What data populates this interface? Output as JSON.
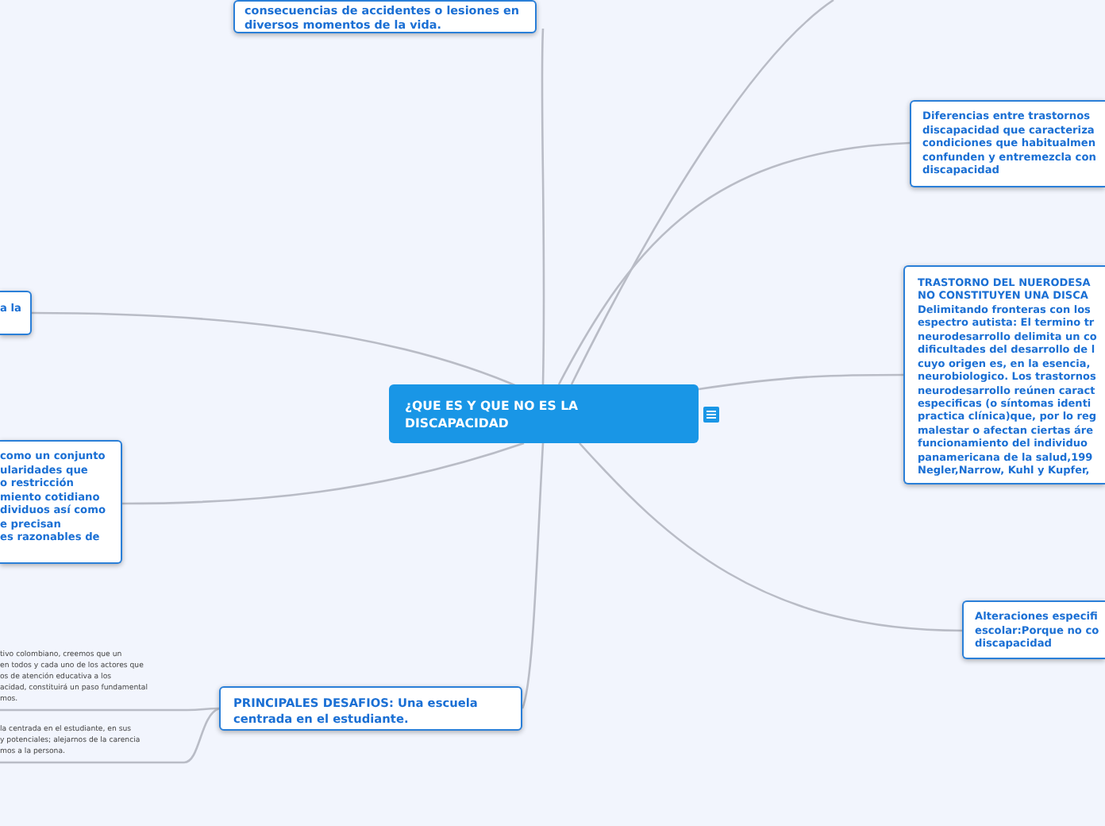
{
  "central": {
    "title": "¿QUE ES Y QUE NO ES LA DISCAPACIDAD"
  },
  "branches": [
    {
      "kind": "topic",
      "lines": [
        "consecuencias de accidentes o lesiones en",
        "diversos momentos de la vida."
      ]
    },
    {
      "kind": "topic",
      "lines": [
        "Diferencias entre trastornos",
        "discapacidad que caracteriza",
        "condiciones que habitualmen",
        "confunden y entremezcla con",
        "discapacidad"
      ]
    },
    {
      "kind": "topic",
      "lines": [
        "a la"
      ]
    },
    {
      "kind": "topic",
      "lines": [
        "TRASTORNO DEL NUERODESA",
        "NO CONSTITUYEN UNA DISCA",
        "Delimitando fronteras con los",
        "espectro autista: El termino tr",
        "neurodesarrollo delimita un co",
        "dificultades del desarrollo de l",
        "cuyo origen es, en la esencia,",
        "neurobiologico. Los trastornos",
        "neurodesarrollo reúnen caract",
        "especificas (o síntomas identi",
        "practica clínica)que, por lo reg",
        "malestar o afectan ciertas áre",
        "funcionamiento del individuo",
        "panamericana de la salud,199",
        "Negler,Narrow, Kuhl y Kupfer,"
      ]
    },
    {
      "kind": "topic",
      "lines": [
        "como un conjunto",
        "ularidades que",
        "o restricción",
        "miento cotidiano",
        "dividuos así como",
        "e precisan",
        "es razonables de"
      ]
    },
    {
      "kind": "topic",
      "lines": [
        "Alteraciones especifi",
        "escolar:Porque no co",
        "discapacidad"
      ]
    },
    {
      "kind": "note",
      "lines": [
        "tivo colombiano, creemos que un",
        "en todos y cada uno de los actores que",
        "os de atención educativa a los",
        "acidad, constituirá un paso fundamental",
        "mos."
      ]
    },
    {
      "kind": "topic",
      "lines": [
        "PRINCIPALES DESAFIOS: Una escuela",
        "centrada en el estudiante."
      ]
    },
    {
      "kind": "note",
      "lines": [
        "la centrada en el estudiante, en sus",
        "y potenciales; alejarnos de la carencia",
        "mos a la persona."
      ]
    }
  ]
}
